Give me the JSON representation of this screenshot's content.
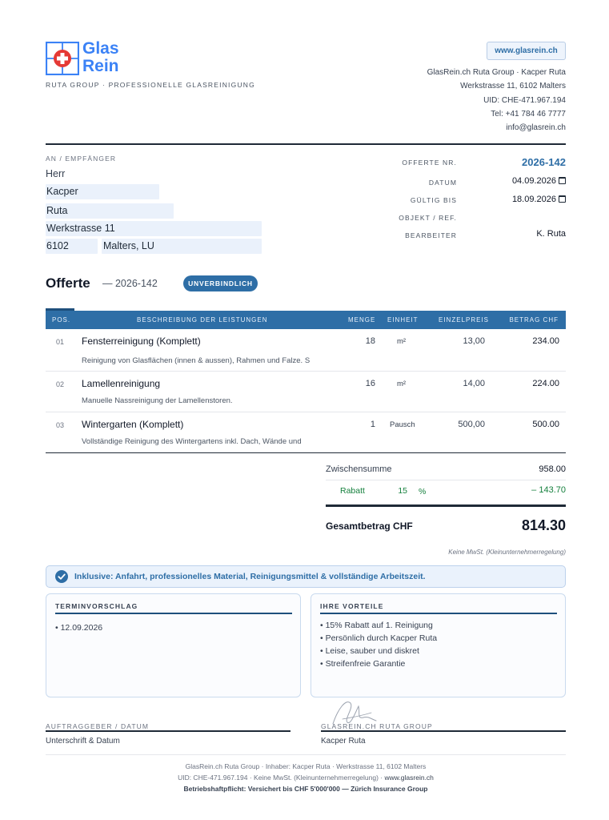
{
  "brand": {
    "logo_line1": "Glas",
    "logo_line2": "Rein",
    "tagline": "RUTA GROUP · PROFESSIONELLE GLASREINIGUNG",
    "website_button": "www.glasrein.ch",
    "sender_lines": [
      "GlasRein.ch Ruta Group · Kacper Ruta",
      "Werkstrasse 11, 6102 Malters",
      "UID: CHE-471.967.194",
      "Tel: +41 784 46 7777",
      "info@glasrein.ch"
    ]
  },
  "recipient": {
    "label": "AN / EMPFÄNGER",
    "salutation": "Herr",
    "first_name": "Kacper",
    "last_name": "Ruta",
    "street": "Werkstrasse 11",
    "zip": "6102",
    "city": "Malters, LU"
  },
  "meta": {
    "offer_no_label": "OFFERTE NR.",
    "offer_no": "2026-142",
    "date_label": "DATUM",
    "date": "04.09.2026",
    "valid_label": "GÜLTIG BIS",
    "valid_until": "18.09.2026",
    "object_label": "OBJEKT / REF.",
    "object": "",
    "clerk_label": "BEARBEITER",
    "clerk": "K. Ruta"
  },
  "title": {
    "heading": "Offerte",
    "subtitle": "— 2026-142",
    "badge": "UNVERBINDLICH"
  },
  "table": {
    "headers": [
      "POS.",
      "BESCHREIBUNG DER LEISTUNGEN",
      "MENGE",
      "EINHEIT",
      "EINZELPREIS",
      "BETRAG CHF"
    ],
    "rows": [
      {
        "pos": "01",
        "title": "Fensterreinigung (Komplett)",
        "desc": "Reinigung von Glasflächen (innen & aussen), Rahmen und Falze. S",
        "qty": "18",
        "unit": "m²",
        "price": "13,00",
        "amount": "234.00"
      },
      {
        "pos": "02",
        "title": "Lamellenreinigung",
        "desc": "Manuelle Nassreinigung der Lamellenstoren.",
        "qty": "16",
        "unit": "m²",
        "price": "14,00",
        "amount": "224.00"
      },
      {
        "pos": "03",
        "title": "Wintergarten (Komplett)",
        "desc": "Vollständige Reinigung des Wintergartens inkl. Dach, Wände und",
        "qty": "1",
        "unit": "Pausch",
        "price": "500,00",
        "amount": "500.00"
      }
    ]
  },
  "totals": {
    "subtotal_label": "Zwischensumme",
    "subtotal": "958.00",
    "discount_label": "Rabatt",
    "discount_value": "15",
    "discount_unit": "%",
    "discount_amount": "– 143.70",
    "total_label": "Gesamtbetrag CHF",
    "total": "814.30",
    "tax_note": "Keine MwSt. (Kleinunternehmerregelung)"
  },
  "info_banner": "Inklusive: Anfahrt, professionelles Material, Reinigungsmittel & vollständige Arbeitszeit.",
  "appointment": {
    "heading": "TERMINVORSCHLAG",
    "items": [
      "• 12.09.2026"
    ]
  },
  "advantages": {
    "heading": "IHRE VORTEILE",
    "items": [
      "• 15% Rabatt auf 1. Reinigung",
      "• Persönlich durch Kacper Ruta",
      "• Leise, sauber und diskret",
      "• Streifenfreie Garantie"
    ]
  },
  "signatures": {
    "left_label": "AUFTRAGGEBER / DATUM",
    "left_name": "Unterschrift & Datum",
    "right_label": "GLASREIN.CH RUTA GROUP",
    "right_name": "Kacper Ruta"
  },
  "footer": {
    "line1": "GlasRein.ch Ruta Group  ·  Inhaber: Kacper Ruta  ·  Werkstrasse 11, 6102 Malters",
    "line2_a": "UID: CHE-471.967.194  ·  Keine MwSt. (Kleinunternehmerregelung)  · ",
    "line2_b": "www.glasrein.ch",
    "line3": "Betriebshaftpflicht: Versichert bis CHF 5'000'000 — Zürich Insurance Group"
  },
  "colors": {
    "accent": "#2e6ea6",
    "logo_blue": "#3b82f6",
    "logo_red": "#e53935",
    "discount_green": "#15803d"
  }
}
